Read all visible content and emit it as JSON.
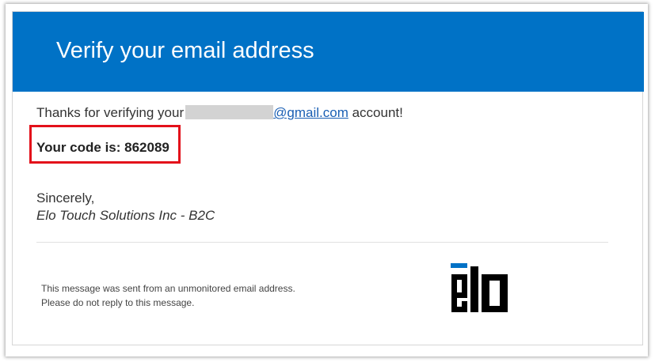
{
  "header": {
    "title": "Verify your email address",
    "background_color": "#0072c6"
  },
  "message": {
    "thanks_prefix": "Thanks for verifying your",
    "email_domain": "@gmail.com",
    "thanks_suffix": " account!",
    "code_line": "Your code is: 862089",
    "highlight_color": "#e3101a",
    "sign_off": "Sincerely,",
    "company": "Elo Touch Solutions Inc - B2C"
  },
  "footer": {
    "note_line_1": "This message was sent from an unmonitored email address.",
    "note_line_2": "Please do not reply to this message.",
    "logo": {
      "text": "elo",
      "accent_color": "#0072c6"
    }
  }
}
